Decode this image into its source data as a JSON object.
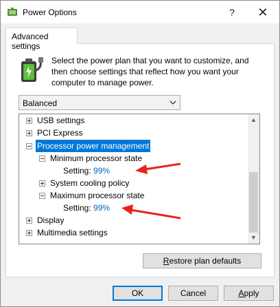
{
  "window": {
    "title": "Power Options",
    "help_label": "?",
    "close_label": "✕"
  },
  "tab": {
    "label": "Advanced settings"
  },
  "description": "Select the power plan that you want to customize, and then choose settings that reflect how you want your computer to manage power.",
  "plan_select": {
    "value": "Balanced"
  },
  "tree": {
    "usb": "USB settings",
    "pci": "PCI Express",
    "processor": "Processor power management",
    "min_state": "Minimum processor state",
    "min_setting_label": "Setting:",
    "min_setting_value": "99%",
    "cooling": "System cooling policy",
    "max_state": "Maximum processor state",
    "max_setting_label": "Setting:",
    "max_setting_value": "99%",
    "display": "Display",
    "multimedia": "Multimedia settings"
  },
  "buttons": {
    "restore_prefix": "R",
    "restore_rest": "estore plan defaults",
    "ok": "OK",
    "cancel": "Cancel",
    "apply_prefix": "A",
    "apply_rest": "pply"
  },
  "colors": {
    "selection": "#0078d7",
    "setting_value": "#0066cc",
    "annotation_arrow": "#e8241a"
  },
  "icons": {
    "title": "power-options-icon",
    "plan": "battery-plug-icon"
  }
}
